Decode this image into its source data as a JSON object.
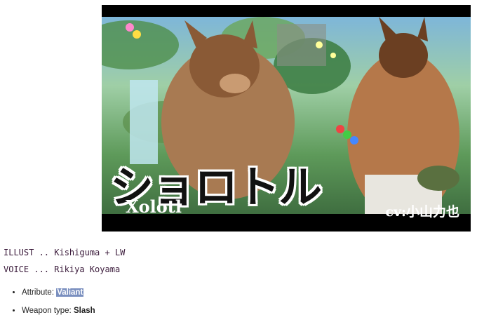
{
  "banner": {
    "title_jp": "ショロトル",
    "name_en": "Xolotl",
    "cv": "cv:小山力也",
    "image_alt": "character-banner-art"
  },
  "credits": {
    "illust": "ILLUST .. Kishiguma + LW",
    "voice": "VOICE ... Rikiya Koyama"
  },
  "info": [
    {
      "label": "Attribute: ",
      "value": "Valiant"
    },
    {
      "label": "Weapon type: ",
      "value": "Slash"
    }
  ]
}
